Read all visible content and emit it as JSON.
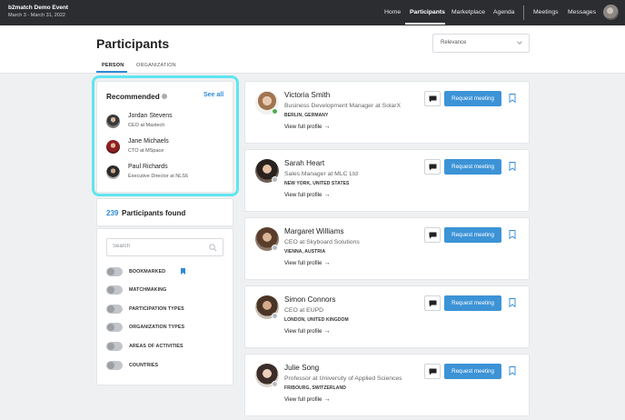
{
  "event": {
    "title": "b2match Demo Event",
    "dates": "March 3 - March 31, 2022"
  },
  "nav": {
    "home": "Home",
    "participants": "Participants",
    "marketplace": "Marketplace",
    "agenda": "Agenda",
    "meetings": "Meetings",
    "messages": "Messages"
  },
  "page": {
    "title": "Participants",
    "sort_value": "Relevance",
    "tabs": {
      "person": "PERSON",
      "organization": "ORGANIZATION"
    }
  },
  "recommended": {
    "title": "Recommended",
    "see_all": "See all",
    "items": [
      {
        "name": "Jordan Stevens",
        "role": "CEO at Maxtech"
      },
      {
        "name": "Jane Michaels",
        "role": "CTO at MSpace"
      },
      {
        "name": "Paul Richards",
        "role": "Executive Director at NLS6"
      }
    ]
  },
  "found": {
    "count": "239",
    "label": "Participants found"
  },
  "filters": {
    "search_placeholder": "Search",
    "items": [
      "BOOKMARKED",
      "MATCHMAKING",
      "PARTICIPATION TYPES",
      "ORGANIZATION TYPES",
      "AREAS OF ACTIVITIES",
      "COUNTRIES"
    ]
  },
  "participants": [
    {
      "name": "Victoria Smith",
      "role": "Business Development Manager at SolarX",
      "location": "BERLIN, GERMANY",
      "online": true
    },
    {
      "name": "Sarah Heart",
      "role": "Sales Manager at MLC Ltd",
      "location": "NEW YORK, UNITED STATES",
      "online": false
    },
    {
      "name": "Margaret Williams",
      "role": "CEO at Skyboard Solutions",
      "location": "VIENNA, AUSTRIA",
      "online": false
    },
    {
      "name": "Simon Connors",
      "role": "CEO at EUPD",
      "location": "LONDON, UNITED KINGDOM",
      "online": false
    },
    {
      "name": "Julie Song",
      "role": "Professor at University of Applied Sciences",
      "location": "FRIBOURG, SWITZERLAND",
      "online": false
    }
  ],
  "labels": {
    "view_profile": "View full profile",
    "request_meeting": "Request meeting"
  },
  "colors": {
    "accent": "#2f8ad4",
    "button": "#3c93d6",
    "online": "#4caf50",
    "offline": "#b8bbc0",
    "highlight": "#5fe6ef"
  }
}
